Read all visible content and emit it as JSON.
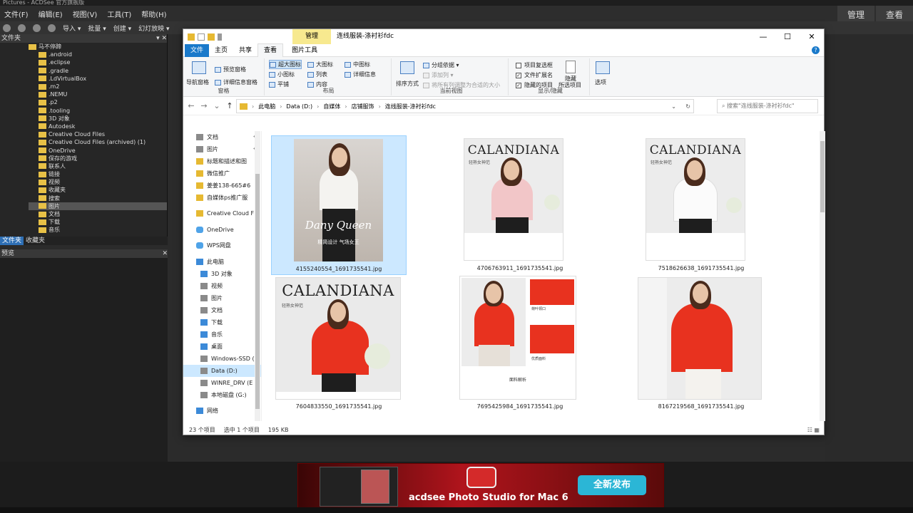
{
  "acdsee": {
    "title": "Pictures - ACDSee 官方旗舰版",
    "menu": [
      "文件(F)",
      "编辑(E)",
      "视图(V)",
      "工具(T)",
      "帮助(H)"
    ],
    "modes": [
      "管理",
      "查看"
    ],
    "toolbar": [
      "导入 ▾",
      "批量 ▾",
      "创建 ▾",
      "幻灯放映 ▾"
    ],
    "folders_header": "文件夹",
    "tree": [
      "马不停蹄",
      ".android",
      ".eclipse",
      ".gradle",
      ".LdVirtualBox",
      ".m2",
      ".NEMU",
      ".p2",
      ".tooling",
      "3D 对象",
      "Autodesk",
      "Creative Cloud Files",
      "Creative Cloud Files (archived) (1)",
      "OneDrive",
      "保存的游戏",
      "联系人",
      "链接",
      "视频",
      "收藏夹",
      "搜索",
      "图片",
      "文档",
      "下载",
      "音乐"
    ],
    "tree_selected_index": 20,
    "panel_tabs": [
      "文件夹",
      "收藏夹"
    ],
    "preview_header": "预览",
    "ad": {
      "tagline": "acdsee Photo Studio for Mac 6",
      "button": "全新发布"
    }
  },
  "explorer": {
    "title": "连线服装-涤衬衫fdc",
    "context_tab": "管理",
    "context_sub_tab": "图片工具",
    "tabs": [
      "文件",
      "主页",
      "共享",
      "查看"
    ],
    "active_tab": "查看",
    "window_controls": [
      "—",
      "☐",
      "✕"
    ],
    "ribbon": {
      "panes_group": {
        "label": "窗格",
        "nav_pane": "导航窗格",
        "preview_pane": "预览窗格",
        "details_pane": "详细信息窗格"
      },
      "layout_group": {
        "label": "布局",
        "items": [
          "超大图标",
          "大图标",
          "中图标",
          "小图标",
          "列表",
          "详细信息",
          "平铺",
          "内容"
        ],
        "selected": "超大图标"
      },
      "current_view_group": {
        "label": "当前视图",
        "sort": "排序方式",
        "group_by": "分组依据 ▾",
        "add_col": "添加列 ▾",
        "fit_cols": "将所有列调整为合适的大小"
      },
      "show_hide_group": {
        "label": "显示/隐藏",
        "checkboxes": [
          {
            "label": "项目复选框",
            "checked": false
          },
          {
            "label": "文件扩展名",
            "checked": true
          },
          {
            "label": "隐藏的项目",
            "checked": true
          }
        ],
        "hide": "隐藏",
        "hide_selected": "所选项目"
      },
      "options": "选项"
    },
    "address": {
      "crumbs": [
        "此电脑",
        "Data (D:)",
        "自媒体",
        "店铺服饰",
        "连线服装-涤衬衫fdc"
      ],
      "search_placeholder": "搜索\"连线服装-涤衬衫fdc\""
    },
    "nav": [
      {
        "label": "文档",
        "icon": "g",
        "pin": true
      },
      {
        "label": "图片",
        "icon": "g",
        "pin": true
      },
      {
        "label": "标题和描述和图",
        "icon": "y"
      },
      {
        "label": "微信推广",
        "icon": "y"
      },
      {
        "label": "姜姜138-665#6",
        "icon": "y"
      },
      {
        "label": "自媒体ps推广服",
        "icon": "y"
      },
      {
        "label": "Creative Cloud F",
        "icon": "y"
      },
      {
        "label": "OneDrive",
        "icon": "c"
      },
      {
        "label": "WPS网盘",
        "icon": "c"
      },
      {
        "label": "此电脑",
        "icon": "b"
      },
      {
        "label": "3D 对象",
        "icon": "b"
      },
      {
        "label": "视频",
        "icon": "g"
      },
      {
        "label": "图片",
        "icon": "g"
      },
      {
        "label": "文档",
        "icon": "g"
      },
      {
        "label": "下载",
        "icon": "b"
      },
      {
        "label": "音乐",
        "icon": "b"
      },
      {
        "label": "桌面",
        "icon": "b"
      },
      {
        "label": "Windows-SSD (",
        "icon": "g"
      },
      {
        "label": "Data (D:)",
        "icon": "g",
        "selected": true
      },
      {
        "label": "WINRE_DRV (E",
        "icon": "g"
      },
      {
        "label": "本地磁盘 (G:)",
        "icon": "g"
      },
      {
        "label": "网络",
        "icon": "b"
      }
    ],
    "files": [
      {
        "name": "4155240554_1691735541.jpg",
        "selected": true,
        "overlay_title": "Dany Queen",
        "overlay_sub": "精简设计 气场女王"
      },
      {
        "name": "4706763911_1691735541.jpg",
        "brand": "CALANDIANA",
        "sub": "轻熟女神范"
      },
      {
        "name": "7518626638_1691735541.jpg",
        "brand": "CALANDIANA",
        "sub": "轻熟女神范"
      },
      {
        "name": "7604833550_1691735541.jpg",
        "brand": "CALANDIANA",
        "sub": "轻熟女神范"
      },
      {
        "name": "7695425984_1691735541.jpg",
        "labels": [
          "荷叶领口",
          "优质面料",
          "面料解析"
        ]
      },
      {
        "name": "8167219568_1691735541.jpg"
      }
    ],
    "status": {
      "count": "23 个项目",
      "selection": "选中 1 个项目",
      "size": "195 KB"
    }
  }
}
